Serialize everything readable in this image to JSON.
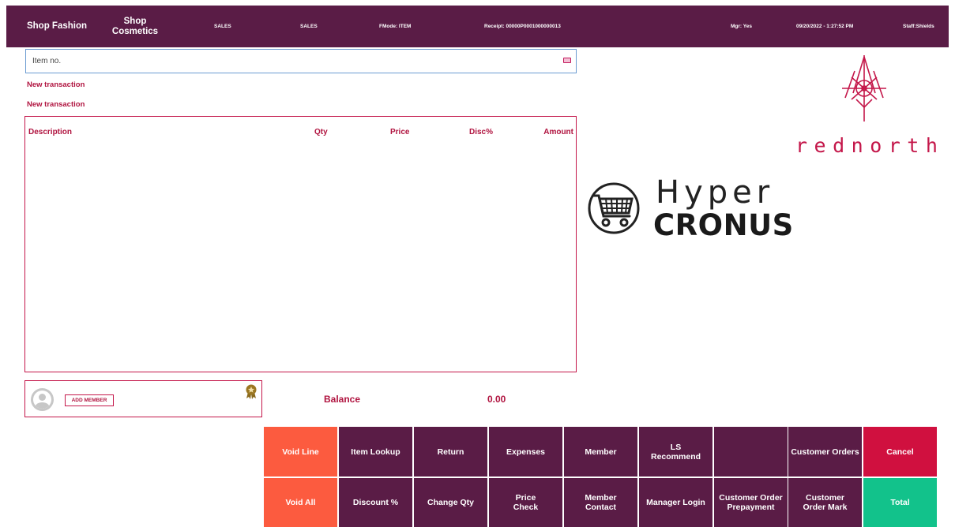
{
  "header": {
    "shop_fashion": "Shop Fashion",
    "shop_cosmetics": "Shop Cosmetics",
    "sales_1": "SALES",
    "sales_2": "SALES",
    "fmode": "FMode: ITEM",
    "receipt": "Receipt: 00000P0001000000013",
    "manager": "Mgr: Yes",
    "datetime": "09/20/2022 - 1:27:52 PM",
    "staff": "Staff:Shields"
  },
  "search": {
    "placeholder": "Item no."
  },
  "transaction": {
    "label_1": "New transaction",
    "label_2": "New transaction",
    "columns": {
      "description": "Description",
      "qty": "Qty",
      "price": "Price",
      "disc": "Disc%",
      "amount": "Amount"
    }
  },
  "member": {
    "add_button": "ADD MEMBER"
  },
  "balance": {
    "label": "Balance",
    "value": "0.00"
  },
  "buttons": {
    "void_line": "Void Line",
    "item_lookup": "Item Lookup",
    "return": "Return",
    "expenses": "Expenses",
    "member": "Member",
    "ls_recommend": "LS Recommend",
    "blank": "",
    "customer_orders": "Customer Orders",
    "cancel": "Cancel",
    "void_all": "Void All",
    "discount": "Discount %",
    "change_qty": "Change Qty",
    "price_check": "Price Check",
    "member_contact": "Member Contact",
    "manager_login": "Manager Login",
    "customer_order_prepayment": "Customer Order Prepayment",
    "customer_order_mark": "Customer Order Mark",
    "total": "Total"
  },
  "logos": {
    "rednorth": "rednorth",
    "hyper": "Hyper",
    "cronus": "CRONUS"
  },
  "colors": {
    "header_bg": "#5a1c46",
    "accent": "#b0133f",
    "void": "#fc5b3f",
    "cancel": "#d0103f",
    "total": "#12c28b"
  },
  "icons": {
    "keyboard": "keyboard-icon",
    "avatar": "user-avatar-icon",
    "badge": "award-badge-icon",
    "rednorth_logo": "rednorth-logo-icon",
    "cart": "shopping-cart-icon"
  }
}
